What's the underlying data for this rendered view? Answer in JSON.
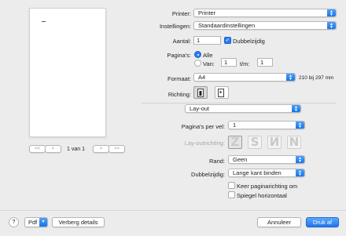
{
  "preview": {
    "page_label": "1 van 1",
    "nav_first": "<<",
    "nav_prev": "<",
    "nav_next": ">",
    "nav_last": ">>"
  },
  "printer": {
    "label": "Printer:",
    "value": "Printer"
  },
  "presets": {
    "label": "Instellingen:",
    "value": "Standaardinstellingen"
  },
  "copies": {
    "label": "Aantal:",
    "value": "1",
    "duplex_label": "Dubbelzijdig",
    "duplex_checked": true
  },
  "pages": {
    "label": "Pagina's:",
    "all_label": "Alle",
    "from_label": "Van:",
    "from_value": "1",
    "to_label": "t/m:",
    "to_value": "1"
  },
  "paper": {
    "label": "Formaat:",
    "value": "A4",
    "size_text": "210 bij 297 mm"
  },
  "orientation": {
    "label": "Richting:"
  },
  "section": {
    "value": "Lay-out"
  },
  "layout": {
    "pages_per_sheet_label": "Pagina's per vel:",
    "pages_per_sheet_value": "1",
    "direction_label": "Lay-outrichting:",
    "border_label": "Rand:",
    "border_value": "Geen",
    "two_sided_label": "Dubbelzijdig:",
    "two_sided_value": "Lange kant binden",
    "reverse_label": "Keer paginarichting om",
    "flip_label": "Spiegel horizontaal"
  },
  "footer": {
    "help": "?",
    "pdf": "Pdf",
    "hide_details": "Verberg details",
    "cancel": "Annuleer",
    "print": "Druk af"
  },
  "colors": {
    "accent": "#2c7df0",
    "window_bg": "#ececec"
  }
}
